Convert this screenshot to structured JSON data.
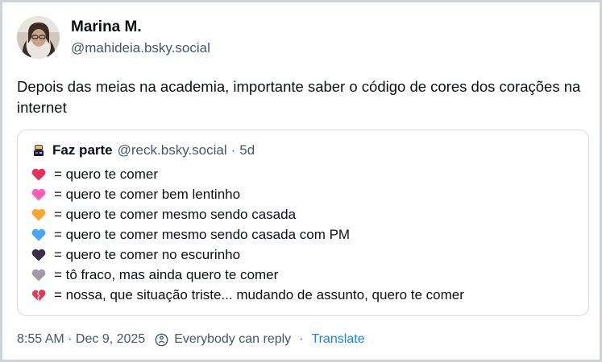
{
  "post": {
    "author_name": "Marina M.",
    "author_handle": "@mahideia.bsky.social",
    "text": "Depois das meias na academia, importante saber o código de cores dos corações na internet"
  },
  "quote": {
    "author_name": "Faz parte",
    "author_handle": "@reck.bsky.social",
    "separator": "·",
    "age": "5d",
    "lines": [
      {
        "heart": "red-heart-icon",
        "color": "#e8315a",
        "text": "= quero te comer"
      },
      {
        "heart": "pink-heart-icon",
        "color": "#ff5fb7",
        "text": "= quero te comer bem lentinho"
      },
      {
        "heart": "orange-heart-icon",
        "color": "#f9a531",
        "text": "= quero te comer mesmo sendo casada"
      },
      {
        "heart": "blue-heart-icon",
        "color": "#45a6f2",
        "text": "= quero te comer mesmo sendo casada com PM"
      },
      {
        "heart": "black-heart-icon",
        "color": "#3a2f48",
        "text": "= quero te comer no escurinho"
      },
      {
        "heart": "grey-heart-icon",
        "color": "#a39aa8",
        "text": "= tô fraco, mas ainda quero te comer"
      },
      {
        "heart": "broken-heart-icon",
        "color": "#e03a57",
        "text": "= nossa, que situação triste... mudando de assunto, quero te comer"
      }
    ]
  },
  "footer": {
    "timestamp": "8:55 AM · Dec 9, 2025",
    "reply_setting": "Everybody can reply",
    "separator": "·",
    "translate_label": "Translate"
  },
  "colors": {
    "link": "#1083fe",
    "muted": "#42576c",
    "border": "#d4dbe2"
  }
}
